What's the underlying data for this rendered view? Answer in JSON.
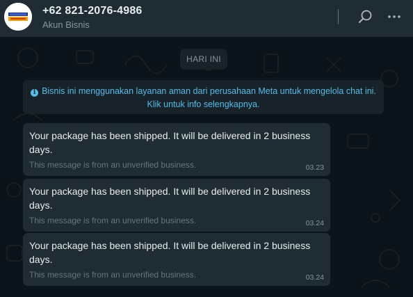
{
  "header": {
    "contact_name": "+62 821-2076-4986",
    "contact_subtitle": "Akun Bisnis",
    "avatar_icon": "business-logo",
    "search_icon": "search-icon",
    "menu_icon": "more-vertical-icon"
  },
  "chat": {
    "date_label": "HARI INI",
    "notice": {
      "icon": "info-icon",
      "line1": "Bisnis ini menggunakan layanan aman dari perusahaan Meta untuk mengelola chat ini.",
      "line2": "Klik untuk info selengkapnya."
    },
    "messages": [
      {
        "text": "Your package has been shipped. It will be delivered in 2 business days.",
        "note": "This message is from an unverified business.",
        "time": "03.23"
      },
      {
        "text": "Your package has been shipped. It will be delivered in 2 business days.",
        "note": "This message is from an unverified business.",
        "time": "03.24"
      },
      {
        "text": "Your package has been shipped. It will be delivered in 2 business days.",
        "note": "This message is from an unverified business.",
        "time": "03.24"
      }
    ]
  },
  "colors": {
    "header_bg": "#202c33",
    "chat_bg": "#0b141a",
    "bubble_bg": "#202c33",
    "link_blue": "#53bdeb",
    "muted_text": "#8696a0"
  }
}
